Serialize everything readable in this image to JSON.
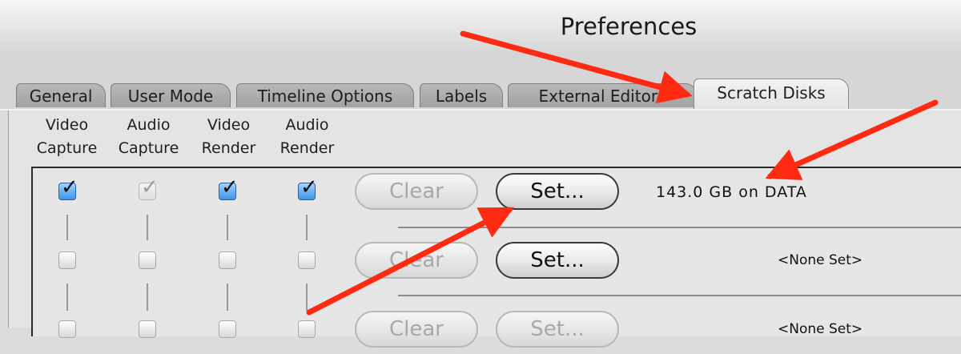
{
  "window": {
    "title": "Preferences"
  },
  "tabs": [
    {
      "label": "General"
    },
    {
      "label": "User Mode"
    },
    {
      "label": "Timeline Options"
    },
    {
      "label": "Labels"
    },
    {
      "label": "External Editors"
    },
    {
      "label": "Scratch Disks",
      "active": true
    }
  ],
  "columns": [
    {
      "line1": "Video",
      "line2": "Capture"
    },
    {
      "line1": "Audio",
      "line2": "Capture"
    },
    {
      "line1": "Video",
      "line2": "Render"
    },
    {
      "line1": "Audio",
      "line2": "Render"
    }
  ],
  "disks": [
    {
      "video_capture": true,
      "audio_capture": true,
      "video_render": true,
      "audio_render": true,
      "audio_capture_dimmed": true,
      "clear_label": "Clear",
      "clear_enabled": false,
      "set_label": "Set...",
      "status": "143.0 GB on DATA"
    },
    {
      "video_capture": false,
      "audio_capture": false,
      "video_render": false,
      "audio_render": false,
      "clear_label": "Clear",
      "clear_enabled": false,
      "set_label": "Set...",
      "status": "<None Set>"
    },
    {
      "video_capture": false,
      "audio_capture": false,
      "video_render": false,
      "audio_render": false,
      "clear_label": "Clear",
      "clear_enabled": false,
      "set_label": "Set...",
      "status": "<None Set>"
    }
  ],
  "annotation": {
    "arrow_color": "#ff2a12"
  },
  "colors": {
    "checked_blue": "#3f95e8"
  }
}
